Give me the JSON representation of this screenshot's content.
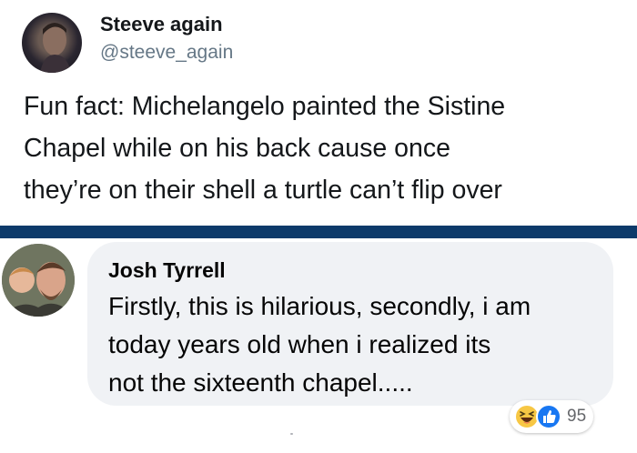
{
  "tweet": {
    "display_name": "Steeve again",
    "handle": "@steeve_again",
    "text": "Fun fact: Michelangelo painted the Sistine\nChapel while on his back cause once\nthey’re on their shell a turtle can’t flip over"
  },
  "facebook_comment": {
    "author": "Josh Tyrrell",
    "text": "Firstly, this is hilarious, secondly, i am\ntoday years old when i realized its\nnot the sixteenth chapel.....",
    "reactions": {
      "icons": [
        "laughing-face-icon",
        "thumbs-up-icon"
      ],
      "count": "95"
    }
  },
  "colors": {
    "divider": "#0d3a6a",
    "bubble": "#f0f2f5",
    "like_blue": "#1877f2",
    "haha_yellow": "#f7c744"
  }
}
